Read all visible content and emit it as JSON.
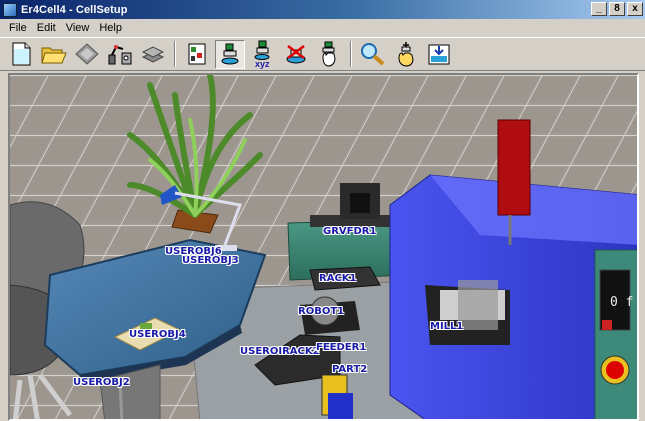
{
  "window": {
    "title": "Er4Cell4 - CellSetup",
    "controls": [
      "_",
      "8",
      "x"
    ]
  },
  "menu": {
    "items": [
      "File",
      "Edit",
      "View",
      "Help"
    ]
  },
  "toolbar": {
    "xyz_caption": "xyz",
    "buttons": [
      "new-file-icon",
      "open-folder-icon",
      "save-disk-icon",
      "robot-arm-icon",
      "layers-icon",
      "cell-setup-icon",
      "place-object-icon",
      "object-xyz-icon",
      "delete-object-icon",
      "pick-object-icon",
      "search-object-icon",
      "hand-move-icon",
      "export-view-icon"
    ]
  },
  "scene": {
    "labels": {
      "userobj6": "USEROBJ6",
      "userobj3": "USEROBJ3",
      "grvfdr1": "GRVFDR1",
      "rack1": "RACK1",
      "robot1": "ROBOT1",
      "userobj4": "USEROBJ4",
      "mill1": "MILL1",
      "useroirack": "USEROIRACK2",
      "feeder1": "FEEDER1",
      "part2": "PART2",
      "userobj2": "USEROBJ2"
    },
    "mill_display": "0 f",
    "colors": {
      "floor": "#a19b95",
      "tile_grout": "#d9d4cf",
      "table": "#3f6f98",
      "mill_body": "#2f3ad6",
      "spindle": "#b00d10",
      "robot_base": "#3a8a76"
    }
  }
}
